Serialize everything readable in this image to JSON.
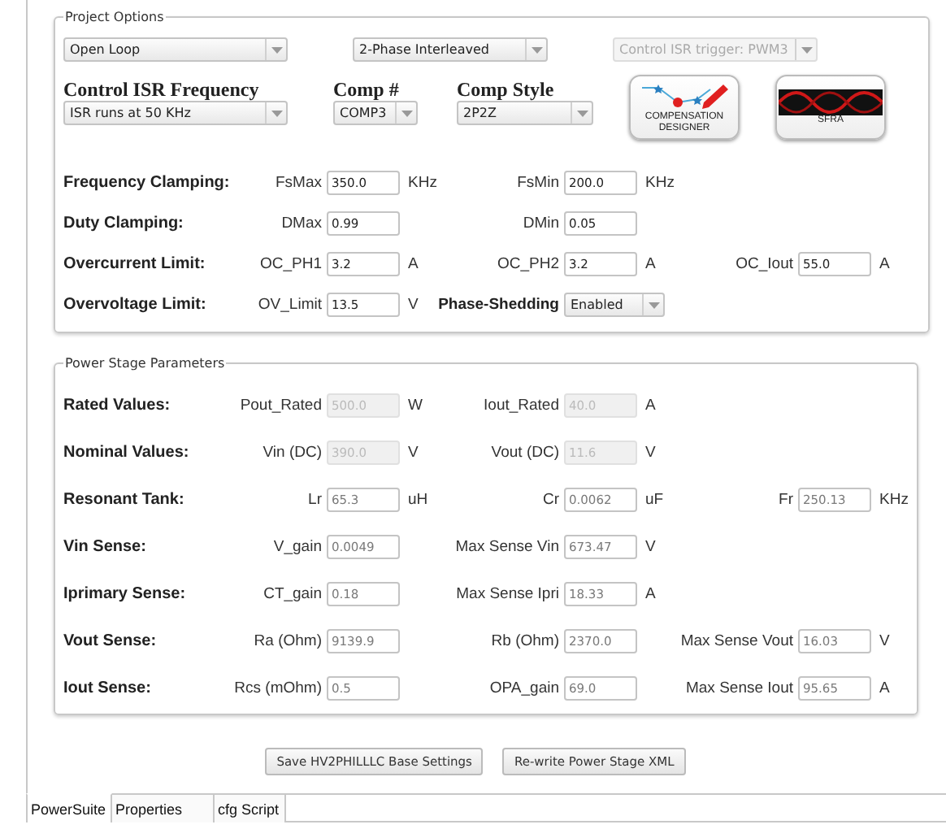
{
  "project_options": {
    "title": "Project Options",
    "dropdowns": [
      {
        "value": "Open Loop",
        "disabled": false
      },
      {
        "value": "2-Phase Interleaved",
        "disabled": false
      },
      {
        "value": "Control ISR trigger: PWM3",
        "disabled": true
      }
    ],
    "selectors": [
      {
        "label": "Control ISR Frequency",
        "value": "ISR runs at 50 KHz"
      },
      {
        "label": "Comp #",
        "value": "COMP3"
      },
      {
        "label": "Comp Style",
        "value": "2P2Z"
      }
    ],
    "tool_buttons": [
      {
        "kind": "compensation",
        "label": "COMPENSATION DESIGNER"
      },
      {
        "kind": "sfra",
        "label": "SFRA"
      }
    ],
    "rows": [
      {
        "heading": "Frequency Clamping:",
        "fields": [
          {
            "kind": "input",
            "label": "FsMax",
            "value": "350.0",
            "unit": "KHz"
          },
          {
            "kind": "input",
            "label": "FsMin",
            "value": "200.0",
            "unit": "KHz"
          }
        ]
      },
      {
        "heading": "Duty Clamping:",
        "fields": [
          {
            "kind": "input",
            "label": "DMax",
            "value": "0.99"
          },
          {
            "kind": "input",
            "label": "DMin",
            "value": "0.05"
          }
        ]
      },
      {
        "heading": "Overcurrent Limit:",
        "fields": [
          {
            "kind": "input",
            "label": "OC_PH1",
            "value": "3.2",
            "unit": "A"
          },
          {
            "kind": "input",
            "label": "OC_PH2",
            "value": "3.2",
            "unit": "A"
          },
          {
            "kind": "input",
            "label": "OC_Iout",
            "value": "55.0",
            "unit": "A"
          }
        ]
      },
      {
        "heading": "Overvoltage Limit:",
        "fields": [
          {
            "kind": "input",
            "label": "OV_Limit",
            "value": "13.5",
            "unit": "V"
          },
          {
            "kind": "select",
            "label": "Phase-Shedding",
            "value": "Enabled"
          }
        ]
      }
    ]
  },
  "power_stage": {
    "title": "Power Stage Parameters",
    "rows": [
      {
        "heading": "Rated Values:",
        "fields": [
          {
            "label": "Pout_Rated",
            "value": "500.0",
            "unit": "W",
            "disabled": true
          },
          {
            "label": "Iout_Rated",
            "value": "40.0",
            "unit": "A",
            "disabled": true
          }
        ]
      },
      {
        "heading": "Nominal Values:",
        "fields": [
          {
            "label": "Vin (DC)",
            "value": "390.0",
            "unit": "V",
            "disabled": true
          },
          {
            "label": "Vout (DC)",
            "value": "11.6",
            "unit": "V",
            "disabled": true
          }
        ]
      },
      {
        "heading": "Resonant Tank:",
        "fields": [
          {
            "label": "Lr",
            "value": "65.3",
            "unit": "uH",
            "disabled": false
          },
          {
            "label": "Cr",
            "value": "0.0062",
            "unit": "uF",
            "disabled": false
          },
          {
            "label": "Fr",
            "value": "250.13",
            "unit": "KHz",
            "disabled": false
          }
        ]
      },
      {
        "heading": "Vin Sense:",
        "fields": [
          {
            "label": "V_gain",
            "value": "0.0049",
            "disabled": false
          },
          {
            "label": "Max Sense Vin",
            "value": "673.47",
            "unit": "V",
            "disabled": false
          }
        ]
      },
      {
        "heading": "Iprimary Sense:",
        "fields": [
          {
            "label": "CT_gain",
            "value": "0.18",
            "disabled": false
          },
          {
            "label": "Max Sense Ipri",
            "value": "18.33",
            "unit": "A",
            "disabled": false
          }
        ]
      },
      {
        "heading": "Vout Sense:",
        "fields": [
          {
            "label": "Ra (Ohm)",
            "value": "9139.9",
            "disabled": false
          },
          {
            "label": "Rb (Ohm)",
            "value": "2370.0",
            "disabled": false
          },
          {
            "label": "Max Sense Vout",
            "value": "16.03",
            "unit": "V",
            "disabled": false
          }
        ]
      },
      {
        "heading": "Iout Sense:",
        "fields": [
          {
            "label": "Rcs (mOhm)",
            "value": "0.5",
            "disabled": false
          },
          {
            "label": "OPA_gain",
            "value": "69.0",
            "disabled": false
          },
          {
            "label": "Max Sense Iout",
            "value": "95.65",
            "unit": "A",
            "disabled": false
          }
        ]
      }
    ]
  },
  "actions": [
    "Save HV2PHILLLC Base Settings",
    "Re-write Power Stage XML"
  ],
  "bottom_tabs": [
    {
      "label": "PowerSuite",
      "selected": true
    },
    {
      "label": "Properties",
      "selected": false
    },
    {
      "label": "cfg Script",
      "selected": false
    }
  ]
}
